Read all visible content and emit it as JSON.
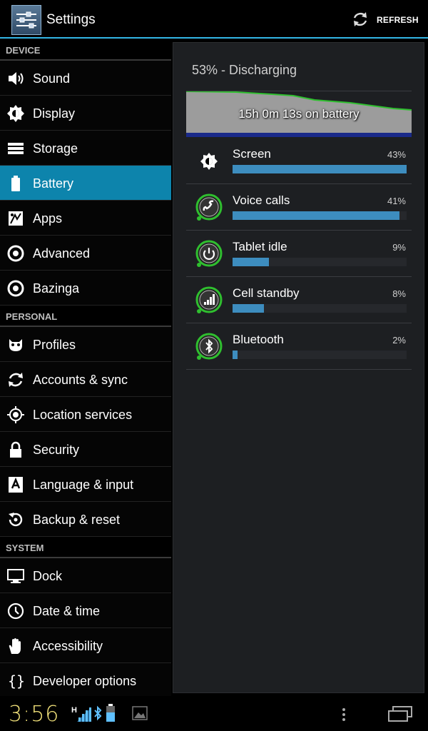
{
  "app": {
    "title": "Settings",
    "refresh_label": "REFRESH"
  },
  "sidebar": {
    "sections": [
      {
        "header": "DEVICE",
        "items": [
          {
            "label": "Sound",
            "icon": "speaker-icon"
          },
          {
            "label": "Display",
            "icon": "brightness-icon"
          },
          {
            "label": "Storage",
            "icon": "storage-icon"
          },
          {
            "label": "Battery",
            "icon": "battery-icon",
            "selected": true
          },
          {
            "label": "Apps",
            "icon": "apps-icon"
          },
          {
            "label": "Advanced",
            "icon": "gear-icon"
          },
          {
            "label": "Bazinga",
            "icon": "gear-icon"
          }
        ]
      },
      {
        "header": "PERSONAL",
        "items": [
          {
            "label": "Profiles",
            "icon": "profiles-icon"
          },
          {
            "label": "Accounts & sync",
            "icon": "sync-icon"
          },
          {
            "label": "Location services",
            "icon": "location-icon"
          },
          {
            "label": "Security",
            "icon": "lock-icon"
          },
          {
            "label": "Language & input",
            "icon": "keyboard-a-icon"
          },
          {
            "label": "Backup & reset",
            "icon": "backup-icon"
          }
        ]
      },
      {
        "header": "SYSTEM",
        "items": [
          {
            "label": "Dock",
            "icon": "monitor-icon"
          },
          {
            "label": "Date & time",
            "icon": "clock-icon"
          },
          {
            "label": "Accessibility",
            "icon": "hand-icon"
          },
          {
            "label": "Developer options",
            "icon": "braces-icon"
          }
        ]
      }
    ]
  },
  "battery": {
    "status": "53% - Discharging",
    "graph_label": "15h 0m 13s on battery",
    "graph_line_color": "#2fbf2f",
    "usage": [
      {
        "name": "Screen",
        "percent": "43%",
        "fraction": 1.0,
        "icon": "brightness-icon"
      },
      {
        "name": "Voice calls",
        "percent": "41%",
        "fraction": 0.96,
        "icon": "phone-icon"
      },
      {
        "name": "Tablet idle",
        "percent": "9%",
        "fraction": 0.21,
        "icon": "power-icon"
      },
      {
        "name": "Cell standby",
        "percent": "8%",
        "fraction": 0.18,
        "icon": "signal-icon"
      },
      {
        "name": "Bluetooth",
        "percent": "2%",
        "fraction": 0.03,
        "icon": "bluetooth-icon"
      }
    ]
  },
  "navbar": {
    "clock": "3:56",
    "clock_color": "#f2e27a"
  },
  "colors": {
    "accent": "#33b5e5",
    "selected_row": "#0d84ac",
    "bar_fill": "#3d8dbf"
  }
}
